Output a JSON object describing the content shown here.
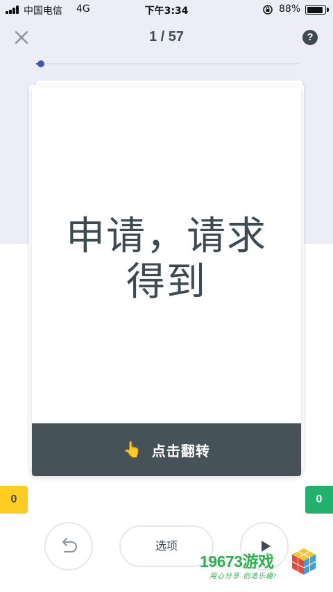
{
  "status_bar": {
    "carrier": "中国电信",
    "network": "4G",
    "time": "下午3:34",
    "battery": "88%"
  },
  "header": {
    "counter": "1 / 57",
    "help_label": "?"
  },
  "progress": {
    "current": 1,
    "total": 57,
    "fraction": 0.0175,
    "accent_color": "#4257b2"
  },
  "card": {
    "term": "申请，请求得到",
    "flip_hint_icon": "pointing-hand-icon",
    "flip_label": "点击翻转"
  },
  "scores": {
    "still_learning": "0",
    "know": "0",
    "still_learning_color": "#ffcd1f",
    "know_color": "#23b26d"
  },
  "controls": {
    "undo_icon": "undo-icon",
    "options_label": "选项",
    "play_icon": "play-icon"
  },
  "watermark": {
    "brand_number": "19673",
    "brand_text": "游戏",
    "slogan": "用心分享 创造乐趣!"
  }
}
